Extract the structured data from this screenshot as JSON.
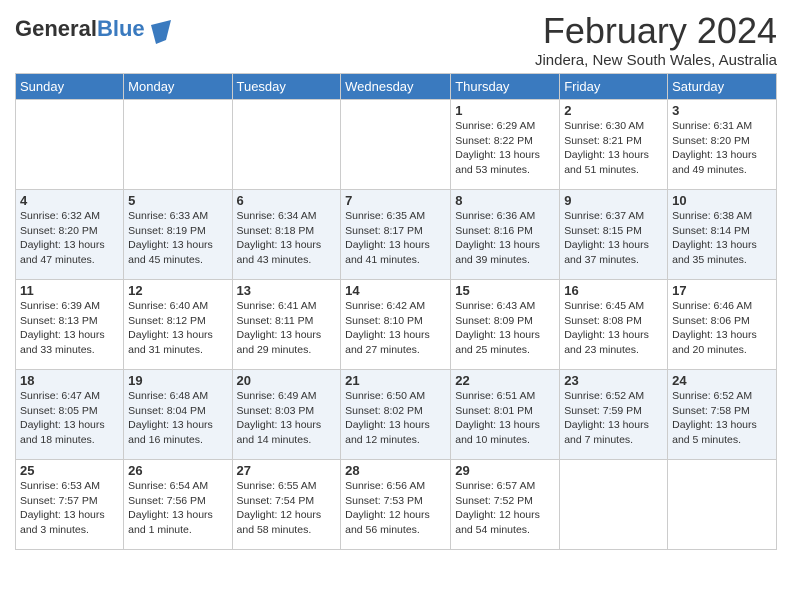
{
  "logo": {
    "general": "General",
    "blue": "Blue"
  },
  "title": "February 2024",
  "location": "Jindera, New South Wales, Australia",
  "days_of_week": [
    "Sunday",
    "Monday",
    "Tuesday",
    "Wednesday",
    "Thursday",
    "Friday",
    "Saturday"
  ],
  "weeks": [
    {
      "days": [
        {
          "num": "",
          "info": ""
        },
        {
          "num": "",
          "info": ""
        },
        {
          "num": "",
          "info": ""
        },
        {
          "num": "",
          "info": ""
        },
        {
          "num": "1",
          "info": "Sunrise: 6:29 AM\nSunset: 8:22 PM\nDaylight: 13 hours\nand 53 minutes."
        },
        {
          "num": "2",
          "info": "Sunrise: 6:30 AM\nSunset: 8:21 PM\nDaylight: 13 hours\nand 51 minutes."
        },
        {
          "num": "3",
          "info": "Sunrise: 6:31 AM\nSunset: 8:20 PM\nDaylight: 13 hours\nand 49 minutes."
        }
      ]
    },
    {
      "days": [
        {
          "num": "4",
          "info": "Sunrise: 6:32 AM\nSunset: 8:20 PM\nDaylight: 13 hours\nand 47 minutes."
        },
        {
          "num": "5",
          "info": "Sunrise: 6:33 AM\nSunset: 8:19 PM\nDaylight: 13 hours\nand 45 minutes."
        },
        {
          "num": "6",
          "info": "Sunrise: 6:34 AM\nSunset: 8:18 PM\nDaylight: 13 hours\nand 43 minutes."
        },
        {
          "num": "7",
          "info": "Sunrise: 6:35 AM\nSunset: 8:17 PM\nDaylight: 13 hours\nand 41 minutes."
        },
        {
          "num": "8",
          "info": "Sunrise: 6:36 AM\nSunset: 8:16 PM\nDaylight: 13 hours\nand 39 minutes."
        },
        {
          "num": "9",
          "info": "Sunrise: 6:37 AM\nSunset: 8:15 PM\nDaylight: 13 hours\nand 37 minutes."
        },
        {
          "num": "10",
          "info": "Sunrise: 6:38 AM\nSunset: 8:14 PM\nDaylight: 13 hours\nand 35 minutes."
        }
      ]
    },
    {
      "days": [
        {
          "num": "11",
          "info": "Sunrise: 6:39 AM\nSunset: 8:13 PM\nDaylight: 13 hours\nand 33 minutes."
        },
        {
          "num": "12",
          "info": "Sunrise: 6:40 AM\nSunset: 8:12 PM\nDaylight: 13 hours\nand 31 minutes."
        },
        {
          "num": "13",
          "info": "Sunrise: 6:41 AM\nSunset: 8:11 PM\nDaylight: 13 hours\nand 29 minutes."
        },
        {
          "num": "14",
          "info": "Sunrise: 6:42 AM\nSunset: 8:10 PM\nDaylight: 13 hours\nand 27 minutes."
        },
        {
          "num": "15",
          "info": "Sunrise: 6:43 AM\nSunset: 8:09 PM\nDaylight: 13 hours\nand 25 minutes."
        },
        {
          "num": "16",
          "info": "Sunrise: 6:45 AM\nSunset: 8:08 PM\nDaylight: 13 hours\nand 23 minutes."
        },
        {
          "num": "17",
          "info": "Sunrise: 6:46 AM\nSunset: 8:06 PM\nDaylight: 13 hours\nand 20 minutes."
        }
      ]
    },
    {
      "days": [
        {
          "num": "18",
          "info": "Sunrise: 6:47 AM\nSunset: 8:05 PM\nDaylight: 13 hours\nand 18 minutes."
        },
        {
          "num": "19",
          "info": "Sunrise: 6:48 AM\nSunset: 8:04 PM\nDaylight: 13 hours\nand 16 minutes."
        },
        {
          "num": "20",
          "info": "Sunrise: 6:49 AM\nSunset: 8:03 PM\nDaylight: 13 hours\nand 14 minutes."
        },
        {
          "num": "21",
          "info": "Sunrise: 6:50 AM\nSunset: 8:02 PM\nDaylight: 13 hours\nand 12 minutes."
        },
        {
          "num": "22",
          "info": "Sunrise: 6:51 AM\nSunset: 8:01 PM\nDaylight: 13 hours\nand 10 minutes."
        },
        {
          "num": "23",
          "info": "Sunrise: 6:52 AM\nSunset: 7:59 PM\nDaylight: 13 hours\nand 7 minutes."
        },
        {
          "num": "24",
          "info": "Sunrise: 6:52 AM\nSunset: 7:58 PM\nDaylight: 13 hours\nand 5 minutes."
        }
      ]
    },
    {
      "days": [
        {
          "num": "25",
          "info": "Sunrise: 6:53 AM\nSunset: 7:57 PM\nDaylight: 13 hours\nand 3 minutes."
        },
        {
          "num": "26",
          "info": "Sunrise: 6:54 AM\nSunset: 7:56 PM\nDaylight: 13 hours\nand 1 minute."
        },
        {
          "num": "27",
          "info": "Sunrise: 6:55 AM\nSunset: 7:54 PM\nDaylight: 12 hours\nand 58 minutes."
        },
        {
          "num": "28",
          "info": "Sunrise: 6:56 AM\nSunset: 7:53 PM\nDaylight: 12 hours\nand 56 minutes."
        },
        {
          "num": "29",
          "info": "Sunrise: 6:57 AM\nSunset: 7:52 PM\nDaylight: 12 hours\nand 54 minutes."
        },
        {
          "num": "",
          "info": ""
        },
        {
          "num": "",
          "info": ""
        }
      ]
    }
  ]
}
